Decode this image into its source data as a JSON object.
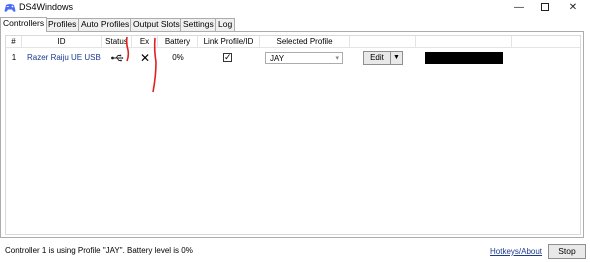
{
  "window": {
    "title": "DS4Windows",
    "minimize": "—",
    "close": "✕"
  },
  "tabs": [
    "Controllers",
    "Profiles",
    "Auto Profiles",
    "Output Slots",
    "Settings",
    "Log"
  ],
  "active_tab": "Controllers",
  "grid": {
    "headers": {
      "num": "#",
      "id": "ID",
      "status": "Status",
      "ex": "Ex",
      "battery": "Battery",
      "link": "Link Profile/ID",
      "profile": "Selected Profile"
    },
    "rows": [
      {
        "num": "1",
        "id": "Razer Raiju UE USB",
        "status_icon": "usb-icon",
        "ex": "✕",
        "battery": "0%",
        "link_checked": true,
        "check": "✓",
        "profile": "JAY",
        "edit": "Edit",
        "dropdown": "▼"
      }
    ]
  },
  "status_bar": {
    "text": "Controller 1 is using Profile \"JAY\". Battery level is 0%",
    "hotkeys": "Hotkeys/About",
    "stop": "Stop"
  },
  "colors": {
    "link_blue": "#1b3a8e",
    "annotation_red": "#e02020",
    "redaction": "#000000"
  }
}
